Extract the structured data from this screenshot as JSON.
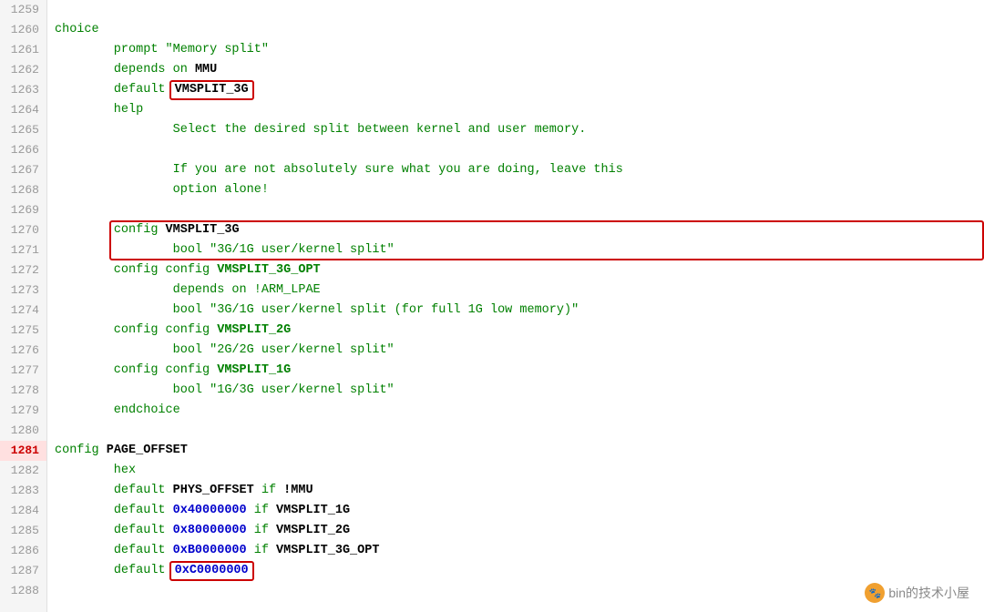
{
  "lines": [
    {
      "num": "1259",
      "content": "",
      "highlight": false
    },
    {
      "num": "1260",
      "content": "choice",
      "type": "keyword-green",
      "highlight": false
    },
    {
      "num": "1261",
      "content": "        prompt \"Memory split\"",
      "type": "string-green",
      "highlight": false
    },
    {
      "num": "1262",
      "content": "        depends on MMU",
      "type": "mixed",
      "highlight": false
    },
    {
      "num": "1263",
      "content": "        default VMSPLIT_3G",
      "type": "boxed-default",
      "highlight": false
    },
    {
      "num": "1264",
      "content": "        help",
      "type": "keyword-green",
      "highlight": false
    },
    {
      "num": "1265",
      "content": "                Select the desired split between kernel and user memory.",
      "type": "green",
      "highlight": false
    },
    {
      "num": "1266",
      "content": "",
      "highlight": false
    },
    {
      "num": "1267",
      "content": "                If you are not absolutely sure what you are doing, leave this",
      "type": "green",
      "highlight": false
    },
    {
      "num": "1268",
      "content": "                option alone!",
      "type": "green",
      "highlight": false
    },
    {
      "num": "1269",
      "content": "",
      "highlight": false
    },
    {
      "num": "1270",
      "content": "        config VMSPLIT_3G",
      "type": "boxed-config",
      "highlight": false
    },
    {
      "num": "1271",
      "content": "                bool \"3G/1G user/kernel split\"",
      "type": "boxed-string",
      "highlight": false
    },
    {
      "num": "1272",
      "content": "        config VMSPLIT_3G_OPT",
      "type": "green-config",
      "highlight": false
    },
    {
      "num": "1273",
      "content": "                depends on !ARM_LPAE",
      "type": "green",
      "highlight": false
    },
    {
      "num": "1274",
      "content": "                bool \"3G/1G user/kernel split (for full 1G low memory)\"",
      "type": "green",
      "highlight": false
    },
    {
      "num": "1275",
      "content": "        config VMSPLIT_2G",
      "type": "green-config",
      "highlight": false
    },
    {
      "num": "1276",
      "content": "                bool \"2G/2G user/kernel split\"",
      "type": "green",
      "highlight": false
    },
    {
      "num": "1277",
      "content": "        config VMSPLIT_1G",
      "type": "green-config",
      "highlight": false
    },
    {
      "num": "1278",
      "content": "                bool \"1G/3G user/kernel split\"",
      "type": "green",
      "highlight": false
    },
    {
      "num": "1279",
      "content": "        endchoice",
      "type": "keyword-green",
      "highlight": false
    },
    {
      "num": "1280",
      "content": "",
      "highlight": false
    },
    {
      "num": "1281",
      "content": "config PAGE_OFFSET",
      "type": "config-bold",
      "highlight": true
    },
    {
      "num": "1282",
      "content": "        hex",
      "type": "green",
      "highlight": false
    },
    {
      "num": "1283",
      "content": "        default PHYS_OFFSET if !MMU",
      "type": "mixed-default",
      "highlight": false
    },
    {
      "num": "1284",
      "content": "        default 0x40000000 if VMSPLIT_1G",
      "type": "mixed-hex",
      "highlight": false
    },
    {
      "num": "1285",
      "content": "        default 0x80000000 if VMSPLIT_2G",
      "type": "mixed-hex",
      "highlight": false
    },
    {
      "num": "1286",
      "content": "        default 0xB0000000 if VMSPLIT_3G_OPT",
      "type": "mixed-hex",
      "highlight": false
    },
    {
      "num": "1287",
      "content": "        default 0xC0000000",
      "type": "boxed-hex-default",
      "highlight": false
    },
    {
      "num": "1288",
      "content": "",
      "highlight": false
    }
  ],
  "watermark": {
    "text": "bin的技术小屋",
    "icon": "🐾"
  }
}
